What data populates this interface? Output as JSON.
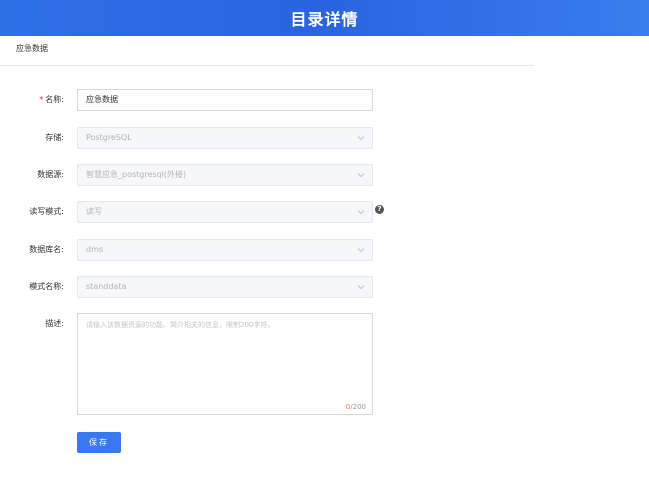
{
  "header": {
    "title": "目录详情"
  },
  "breadcrumb": {
    "text": "应急数据"
  },
  "form": {
    "name": {
      "label": "名称:",
      "required_mark": "*",
      "value": "应急数据"
    },
    "storage": {
      "label": "存储:",
      "value": "PostgreSQL"
    },
    "datasource": {
      "label": "数据源:",
      "value": "智慧应急_postgresql(外接)"
    },
    "rw_mode": {
      "label": "读写模式:",
      "value": "读写",
      "help": "?"
    },
    "database": {
      "label": "数据库名:",
      "value": "dms"
    },
    "schema": {
      "label": "模式名称:",
      "value": "standdata"
    },
    "description": {
      "label": "描述:",
      "placeholder": "请输入该数据资源的功能、简介相关的信息，限制200字符。",
      "count": "0",
      "max": "/200"
    }
  },
  "actions": {
    "save_label": "保存"
  },
  "icons": {
    "chevron": "chevron-down-icon",
    "help": "question-circle-icon"
  },
  "colors": {
    "header": "#2a64e0",
    "primary": "#3a78f2",
    "required": "#f5222d"
  }
}
